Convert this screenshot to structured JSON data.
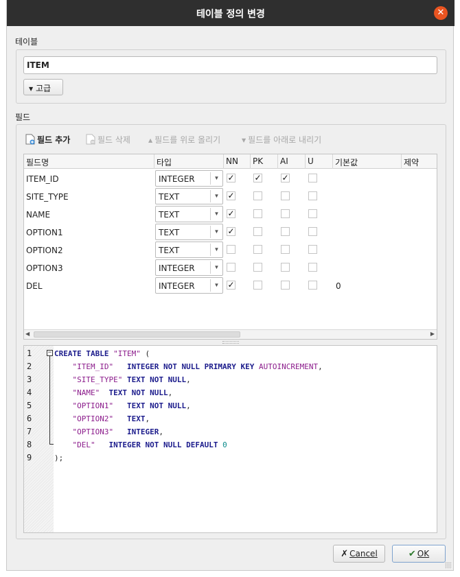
{
  "window": {
    "title": "테이블 정의 변경"
  },
  "table_section": {
    "label": "테이블",
    "name_value": "ITEM",
    "advanced_label": "고급"
  },
  "fields_section": {
    "label": "필드"
  },
  "toolbar": {
    "add_field": "필드 추가",
    "remove_field": "필드 삭제",
    "move_up": "필드를 위로 올리기",
    "move_down": "필드를 아래로 내리기"
  },
  "columns": [
    "필드명",
    "타입",
    "NN",
    "PK",
    "AI",
    "U",
    "기본값",
    "제약"
  ],
  "fields": [
    {
      "name": "ITEM_ID",
      "type": "INTEGER",
      "nn": true,
      "pk": true,
      "ai": true,
      "u": false,
      "default": ""
    },
    {
      "name": "SITE_TYPE",
      "type": "TEXT",
      "nn": true,
      "pk": false,
      "ai": false,
      "u": false,
      "default": ""
    },
    {
      "name": "NAME",
      "type": "TEXT",
      "nn": true,
      "pk": false,
      "ai": false,
      "u": false,
      "default": ""
    },
    {
      "name": "OPTION1",
      "type": "TEXT",
      "nn": true,
      "pk": false,
      "ai": false,
      "u": false,
      "default": ""
    },
    {
      "name": "OPTION2",
      "type": "TEXT",
      "nn": false,
      "pk": false,
      "ai": false,
      "u": false,
      "default": ""
    },
    {
      "name": "OPTION3",
      "type": "INTEGER",
      "nn": false,
      "pk": false,
      "ai": false,
      "u": false,
      "default": ""
    },
    {
      "name": "DEL",
      "type": "INTEGER",
      "nn": true,
      "pk": false,
      "ai": false,
      "u": false,
      "default": "0"
    }
  ],
  "sql": {
    "line_numbers": [
      "1",
      "2",
      "3",
      "4",
      "5",
      "6",
      "7",
      "8",
      "9"
    ],
    "lines": [
      [
        [
          "kw",
          "CREATE TABLE "
        ],
        [
          "str",
          "\"ITEM\""
        ],
        [
          "p",
          " ("
        ]
      ],
      [
        [
          "p",
          "    "
        ],
        [
          "str",
          "\"ITEM_ID\""
        ],
        [
          "p",
          "   "
        ],
        [
          "kw",
          "INTEGER NOT NULL PRIMARY KEY "
        ],
        [
          "fn",
          "AUTOINCREMENT"
        ],
        [
          "p",
          ","
        ]
      ],
      [
        [
          "p",
          "    "
        ],
        [
          "str",
          "\"SITE_TYPE\""
        ],
        [
          "p",
          " "
        ],
        [
          "kw",
          "TEXT NOT NULL"
        ],
        [
          "p",
          ","
        ]
      ],
      [
        [
          "p",
          "    "
        ],
        [
          "str",
          "\"NAME\""
        ],
        [
          "p",
          "  "
        ],
        [
          "kw",
          "TEXT NOT NULL"
        ],
        [
          "p",
          ","
        ]
      ],
      [
        [
          "p",
          "    "
        ],
        [
          "str",
          "\"OPTION1\""
        ],
        [
          "p",
          "   "
        ],
        [
          "kw",
          "TEXT NOT NULL"
        ],
        [
          "p",
          ","
        ]
      ],
      [
        [
          "p",
          "    "
        ],
        [
          "str",
          "\"OPTION2\""
        ],
        [
          "p",
          "   "
        ],
        [
          "kw",
          "TEXT"
        ],
        [
          "p",
          ","
        ]
      ],
      [
        [
          "p",
          "    "
        ],
        [
          "str",
          "\"OPTION3\""
        ],
        [
          "p",
          "   "
        ],
        [
          "kw",
          "INTEGER"
        ],
        [
          "p",
          ","
        ]
      ],
      [
        [
          "p",
          "    "
        ],
        [
          "str",
          "\"DEL\""
        ],
        [
          "p",
          "   "
        ],
        [
          "kw",
          "INTEGER NOT NULL DEFAULT "
        ],
        [
          "num",
          "0"
        ]
      ],
      [
        [
          "p",
          ");"
        ]
      ]
    ]
  },
  "buttons": {
    "cancel": "Cancel",
    "ok": "OK"
  },
  "colors": {
    "titlebar": "#2f2f2f",
    "close": "#e95420",
    "keyword": "#1c1c8c",
    "string": "#8b1b8b",
    "number": "#0a8a8a"
  }
}
